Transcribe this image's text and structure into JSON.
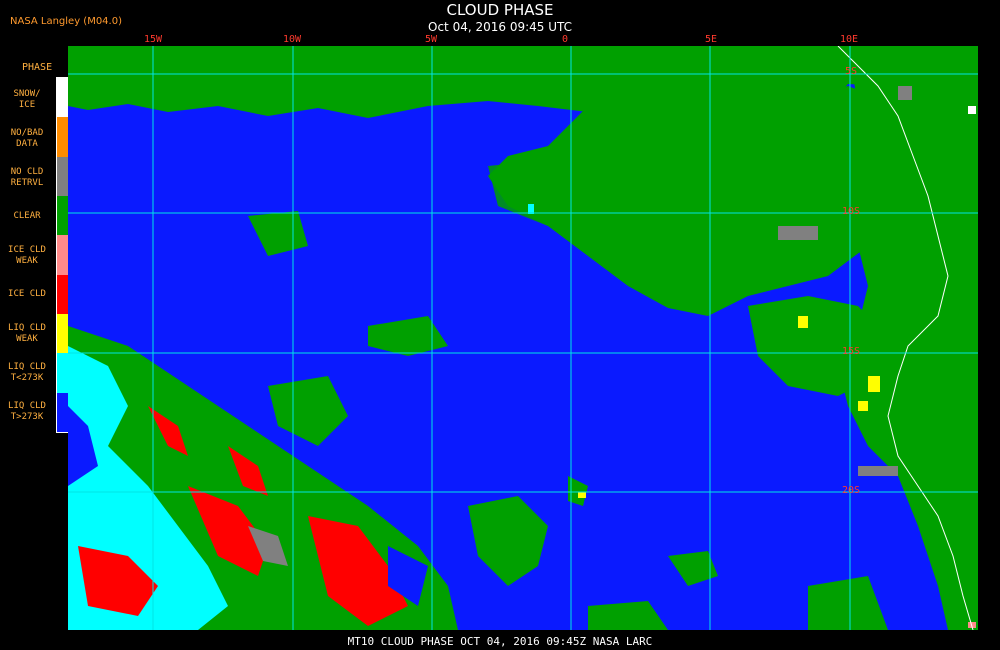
{
  "credit": "NASA Langley (M04.0)",
  "title": "CLOUD PHASE",
  "timestamp": "Oct 04, 2016 09:45 UTC",
  "footer": "MT10  CLOUD PHASE  OCT 04, 2016 09:45Z  NASA LARC",
  "legend": {
    "title": "PHASE",
    "items": [
      {
        "label": "SNOW/\nICE",
        "color": "#ffffff"
      },
      {
        "label": "NO/BAD\nDATA",
        "color": "#ff8c00"
      },
      {
        "label": "NO CLD\nRETRVL",
        "color": "#808080"
      },
      {
        "label": "CLEAR",
        "color": "#00a000"
      },
      {
        "label": "ICE CLD\nWEAK",
        "color": "#ff8a8a"
      },
      {
        "label": "ICE CLD",
        "color": "#ff0000"
      },
      {
        "label": "LIQ CLD\nWEAK",
        "color": "#ffff00"
      },
      {
        "label": "LIQ CLD\nT<273K",
        "color": "#00ffff"
      },
      {
        "label": "LIQ CLD\nT>273K",
        "color": "#0a1aff"
      }
    ]
  },
  "grid": {
    "lon_labels": [
      "15W",
      "10W",
      "5W",
      "0",
      "5E",
      "10E"
    ],
    "lat_labels": [
      "5S",
      "10S",
      "15S",
      "20S"
    ]
  },
  "colors": {
    "ocean_liq_warm": "#0a1aff",
    "clear_land": "#00a000",
    "grid": "#00e5e5",
    "label_orange": "#ffb040",
    "label_red": "#ff3a2e"
  }
}
